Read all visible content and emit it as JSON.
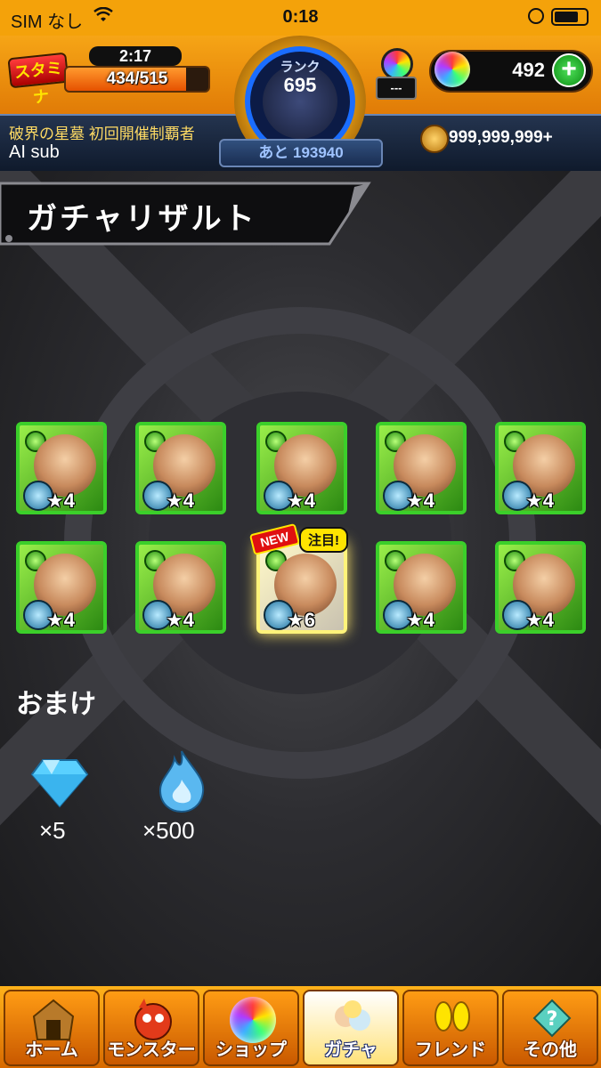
{
  "status_bar": {
    "carrier": "SIM なし",
    "time": "0:18"
  },
  "header": {
    "stamina_label": "スタミナ",
    "stamina_timer": "2:17",
    "stamina_value": "434/515",
    "stamina_fraction": 0.843,
    "rank_label": "ランク",
    "rank_value": "695",
    "rank_next": "あと 193940",
    "gacha_counter": "---",
    "orb_count": "492",
    "orb_add": "+",
    "player_title": "破界の星墓 初回開催制覇者",
    "player_name": "AI sub",
    "coins": "999,999,999+"
  },
  "page_title": "ガチャリザルト",
  "results": [
    {
      "stars": "★4"
    },
    {
      "stars": "★4"
    },
    {
      "stars": "★4"
    },
    {
      "stars": "★4"
    },
    {
      "stars": "★4"
    },
    {
      "stars": "★4"
    },
    {
      "stars": "★4"
    },
    {
      "stars": "★6"
    },
    {
      "stars": "★4"
    },
    {
      "stars": "★4"
    }
  ],
  "badges": {
    "new": "NEW",
    "note": "注目!"
  },
  "bonus": {
    "title": "おまけ",
    "items": [
      {
        "icon": "diamond-icon",
        "label": "×5"
      },
      {
        "icon": "flame-icon",
        "label": "×500"
      }
    ]
  },
  "nav": [
    {
      "label": "ホーム",
      "icon": "home-icon"
    },
    {
      "label": "モンスター",
      "icon": "monster-icon"
    },
    {
      "label": "ショップ",
      "icon": "shop-orb-icon"
    },
    {
      "label": "ガチャ",
      "icon": "gacha-icon"
    },
    {
      "label": "フレンド",
      "icon": "friend-icon"
    },
    {
      "label": "その他",
      "icon": "other-icon"
    }
  ],
  "colors": {
    "accent": "#f4a20a",
    "rarity_green": "#3bcf2a",
    "rank_blue": "#1a6dff"
  }
}
